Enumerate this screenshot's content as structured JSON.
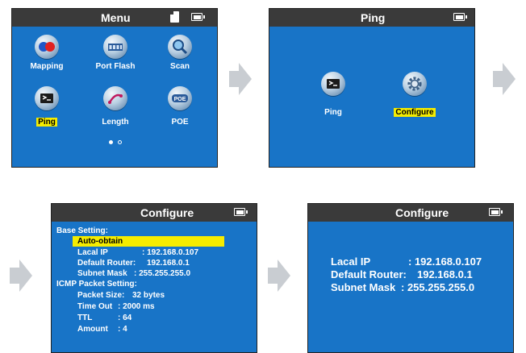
{
  "screens": {
    "menu": {
      "title": "Menu",
      "items": [
        {
          "label": "Mapping",
          "icon": "mapping-icon"
        },
        {
          "label": "Port Flash",
          "icon": "port-flash-icon"
        },
        {
          "label": "Scan",
          "icon": "scan-icon"
        },
        {
          "label": "Ping",
          "icon": "ping-icon",
          "highlighted": true
        },
        {
          "label": "Length",
          "icon": "length-icon"
        },
        {
          "label": "POE",
          "icon": "poe-icon"
        }
      ],
      "page_indicator": {
        "current": 1,
        "total": 2
      }
    },
    "ping": {
      "title": "Ping",
      "items": [
        {
          "label": "Ping",
          "icon": "ping-icon"
        },
        {
          "label": "Configure",
          "icon": "gear-icon",
          "highlighted": true
        }
      ]
    },
    "configure_detail": {
      "title": "Configure",
      "base_setting_label": "Base Setting:",
      "auto_obtain": "Auto-obtain",
      "local_ip_label": "Lacal IP",
      "local_ip_value": ": 192.168.0.107",
      "router_label": "Default Router:",
      "router_value": "192.168.0.1",
      "subnet_label": "Subnet Mask",
      "subnet_value": ": 255.255.255.0",
      "icmp_label": "ICMP Packet Setting:",
      "packet_size_label": "Packet Size:",
      "packet_size_value": "32 bytes",
      "timeout_label": "Time Out",
      "timeout_value": ": 2000 ms",
      "ttl_label": "TTL",
      "ttl_value": ": 64",
      "amount_label": "Amount",
      "amount_value": ": 4"
    },
    "configure_summary": {
      "title": "Configure",
      "local_ip_label": "Lacal IP",
      "local_ip_value": ": 192.168.0.107",
      "router_label": "Default Router:",
      "router_value": "192.168.0.1",
      "subnet_label": "Subnet Mask",
      "subnet_value": ": 255.255.255.0"
    }
  },
  "colors": {
    "screen_bg": "#1874c7",
    "titlebar_bg": "#3a3a3a",
    "highlight": "#f5ec00",
    "arrow": "#c9cdd2"
  }
}
